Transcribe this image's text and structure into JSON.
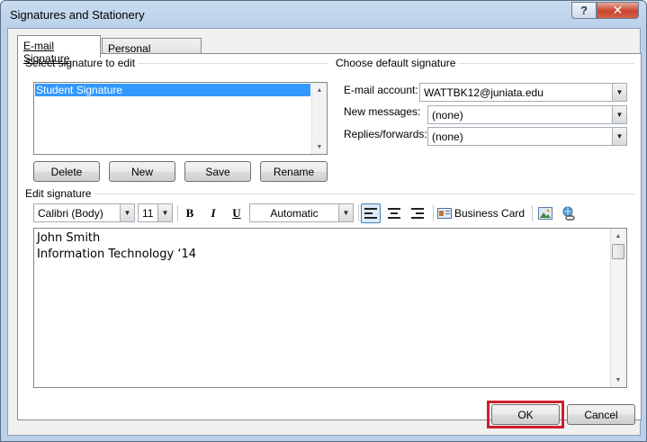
{
  "window": {
    "title": "Signatures and Stationery",
    "help_glyph": "?",
    "close_glyph": "✕"
  },
  "tabs": [
    {
      "label": "E-mail Signature",
      "active": true
    },
    {
      "label": "Personal Stationery",
      "active": false
    }
  ],
  "select_signature": {
    "group_label": "Select signature to edit",
    "items": [
      "Student Signature"
    ],
    "selected_index": 0,
    "buttons": {
      "delete": "Delete",
      "new": "New",
      "save": "Save",
      "rename": "Rename"
    }
  },
  "default_signature": {
    "group_label": "Choose default signature",
    "email_account_label": "E-mail account:",
    "email_account_value": "WATTBK12@juniata.edu",
    "new_messages_label": "New messages:",
    "new_messages_value": "(none)",
    "replies_label": "Replies/forwards:",
    "replies_value": "(none)"
  },
  "edit_signature": {
    "group_label": "Edit signature",
    "font_value": "Calibri (Body)",
    "size_value": "11",
    "bold_label": "B",
    "italic_label": "I",
    "underline_label": "U",
    "color_value": "Automatic",
    "business_card_label": "Business Card",
    "content_lines": [
      "John Smith",
      "Information Technology ‘14"
    ]
  },
  "footer": {
    "ok_label": "OK",
    "cancel_label": "Cancel"
  },
  "colors": {
    "highlight": "#d11f2a",
    "selection": "#3399ff",
    "titlebar": "#b9d1ea"
  }
}
